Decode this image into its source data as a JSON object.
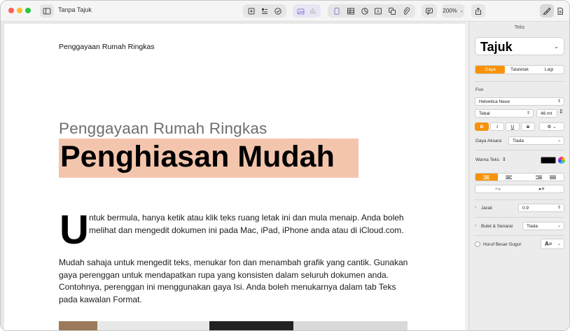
{
  "window": {
    "title": "Tanpa Tajuk",
    "zoom": "200%"
  },
  "toolbar": {
    "left_icons": [
      "sidebar-icon"
    ],
    "insert_icons": [
      "add-page-icon",
      "toc-icon",
      "comment-icon"
    ],
    "media_icons": [
      "image-icon",
      "chart-icon"
    ],
    "object_icons": [
      "text-box-icon",
      "table-icon",
      "chart-icon",
      "text-icon",
      "shape-icon",
      "media-icon"
    ],
    "right_icons": [
      "share-icon",
      "format-brush-icon",
      "document-icon"
    ]
  },
  "document": {
    "running_head": "Penggayaan Rumah Ringkas",
    "subtitle": "Penggayaan Rumah Ringkas",
    "title": "Penghiasan Mudah",
    "dropcap": "U",
    "paragraph1": "ntuk bermula, hanya ketik atau klik teks ruang letak ini dan mula menaip. Anda boleh melihat dan mengedit dokumen ini pada Mac, iPad, iPhone anda atau di iCloud.com.",
    "paragraph2": "Mudah sahaja untuk mengedit teks, menukar fon dan menambah grafik yang cantik. Gunakan gaya perenggan untuk mendapatkan rupa yang konsisten dalam seluruh dokumen anda. Contohnya, perenggan ini menggunakan gaya Isi. Anda boleh menukarnya dalam tab Teks pada kawalan Format.",
    "highlight_color": "#f4c5ad"
  },
  "inspector": {
    "header": "Teks",
    "paragraph_style": "Tajuk",
    "tabs": [
      {
        "label": "Gaya",
        "active": true
      },
      {
        "label": "Tataletak",
        "active": false
      },
      {
        "label": "Lagi",
        "active": false
      }
    ],
    "font_label": "Fon",
    "font_family": "Helvetica Neue",
    "font_weight": "Tebal",
    "font_size": "46 mt",
    "style_buttons": [
      "B",
      "I",
      "U",
      "S"
    ],
    "char_style_label": "Gaya Aksara",
    "char_style_value": "Tiada",
    "text_color_label": "Warna Teks",
    "text_color": "#000000",
    "spacing_label": "Jarak",
    "spacing_value": "0.9",
    "bullets_label": "Bulet & Senarai",
    "bullets_value": "Tiada",
    "dropcap_label": "Huruf Besar Gugur",
    "accent_color": "#f7920a"
  }
}
